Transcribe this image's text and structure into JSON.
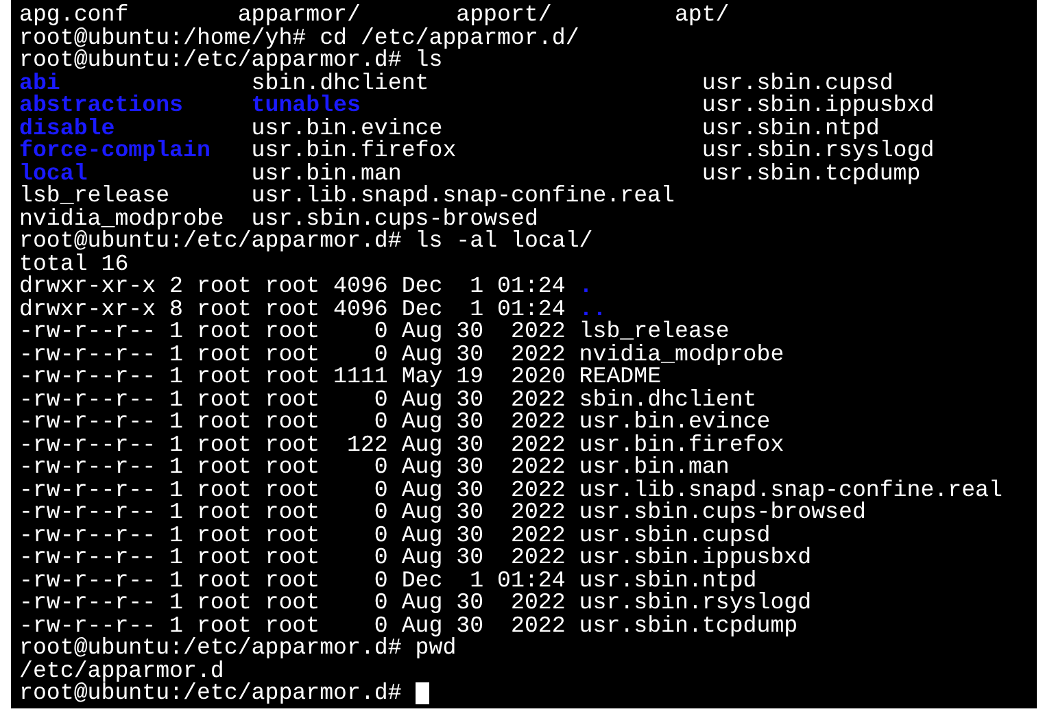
{
  "terminal": {
    "lines": [
      {
        "kind": "grid4",
        "cells": [
          {
            "text": "apg.conf",
            "directory": false
          },
          {
            "text": "apparmor/",
            "directory": false
          },
          {
            "text": "apport/",
            "directory": false
          },
          {
            "text": "apt/",
            "directory": false
          }
        ]
      },
      {
        "kind": "text",
        "text": "root@ubuntu:/home/yh# cd /etc/apparmor.d/"
      },
      {
        "kind": "text",
        "text": "root@ubuntu:/etc/apparmor.d# ls"
      },
      {
        "kind": "grid3",
        "cells": [
          {
            "text": "abi",
            "directory": true
          },
          {
            "text": "sbin.dhclient",
            "directory": false
          },
          {
            "text": "usr.sbin.cupsd",
            "directory": false
          }
        ]
      },
      {
        "kind": "grid3",
        "cells": [
          {
            "text": "abstractions",
            "directory": true
          },
          {
            "text": "tunables",
            "directory": true
          },
          {
            "text": "usr.sbin.ippusbxd",
            "directory": false
          }
        ]
      },
      {
        "kind": "grid3",
        "cells": [
          {
            "text": "disable",
            "directory": true
          },
          {
            "text": "usr.bin.evince",
            "directory": false
          },
          {
            "text": "usr.sbin.ntpd",
            "directory": false
          }
        ]
      },
      {
        "kind": "grid3",
        "cells": [
          {
            "text": "force-complain",
            "directory": true
          },
          {
            "text": "usr.bin.firefox",
            "directory": false
          },
          {
            "text": "usr.sbin.rsyslogd",
            "directory": false
          }
        ]
      },
      {
        "kind": "grid3",
        "cells": [
          {
            "text": "local",
            "directory": true
          },
          {
            "text": "usr.bin.man",
            "directory": false
          },
          {
            "text": "usr.sbin.tcpdump",
            "directory": false
          }
        ]
      },
      {
        "kind": "grid3",
        "cells": [
          {
            "text": "lsb_release",
            "directory": false
          },
          {
            "text": "usr.lib.snapd.snap-confine.real",
            "directory": false
          }
        ]
      },
      {
        "kind": "grid3",
        "cells": [
          {
            "text": "nvidia_modprobe",
            "directory": false
          },
          {
            "text": "usr.sbin.cups-browsed",
            "directory": false
          }
        ]
      },
      {
        "kind": "text",
        "text": "root@ubuntu:/etc/apparmor.d# ls -al local/"
      },
      {
        "kind": "text",
        "text": "total 16"
      },
      {
        "kind": "listing",
        "text": "drwxr-xr-x 2 root root 4096 Dec  1 01:24",
        "name": ".",
        "directory": true
      },
      {
        "kind": "listing",
        "text": "drwxr-xr-x 8 root root 4096 Dec  1 01:24",
        "name": "..",
        "directory": true
      },
      {
        "kind": "listing",
        "text": "-rw-r--r-- 1 root root    0 Aug 30  2022",
        "name": "lsb_release",
        "directory": false
      },
      {
        "kind": "listing",
        "text": "-rw-r--r-- 1 root root    0 Aug 30  2022",
        "name": "nvidia_modprobe",
        "directory": false
      },
      {
        "kind": "listing",
        "text": "-rw-r--r-- 1 root root 1111 May 19  2020",
        "name": "README",
        "directory": false
      },
      {
        "kind": "listing",
        "text": "-rw-r--r-- 1 root root    0 Aug 30  2022",
        "name": "sbin.dhclient",
        "directory": false
      },
      {
        "kind": "listing",
        "text": "-rw-r--r-- 1 root root    0 Aug 30  2022",
        "name": "usr.bin.evince",
        "directory": false
      },
      {
        "kind": "listing",
        "text": "-rw-r--r-- 1 root root  122 Aug 30  2022",
        "name": "usr.bin.firefox",
        "directory": false
      },
      {
        "kind": "listing",
        "text": "-rw-r--r-- 1 root root    0 Aug 30  2022",
        "name": "usr.bin.man",
        "directory": false
      },
      {
        "kind": "listing",
        "text": "-rw-r--r-- 1 root root    0 Aug 30  2022",
        "name": "usr.lib.snapd.snap-confine.real",
        "directory": false
      },
      {
        "kind": "listing",
        "text": "-rw-r--r-- 1 root root    0 Aug 30  2022",
        "name": "usr.sbin.cups-browsed",
        "directory": false
      },
      {
        "kind": "listing",
        "text": "-rw-r--r-- 1 root root    0 Aug 30  2022",
        "name": "usr.sbin.cupsd",
        "directory": false
      },
      {
        "kind": "listing",
        "text": "-rw-r--r-- 1 root root    0 Aug 30  2022",
        "name": "usr.sbin.ippusbxd",
        "directory": false
      },
      {
        "kind": "listing",
        "text": "-rw-r--r-- 1 root root    0 Dec  1 01:24",
        "name": "usr.sbin.ntpd",
        "directory": false
      },
      {
        "kind": "listing",
        "text": "-rw-r--r-- 1 root root    0 Aug 30  2022",
        "name": "usr.sbin.rsyslogd",
        "directory": false
      },
      {
        "kind": "listing",
        "text": "-rw-r--r-- 1 root root    0 Aug 30  2022",
        "name": "usr.sbin.tcpdump",
        "directory": false
      },
      {
        "kind": "text",
        "text": "root@ubuntu:/etc/apparmor.d# pwd"
      },
      {
        "kind": "text",
        "text": "/etc/apparmor.d"
      },
      {
        "kind": "text",
        "text": "root@ubuntu:/etc/apparmor.d#",
        "cursor": true
      }
    ]
  }
}
